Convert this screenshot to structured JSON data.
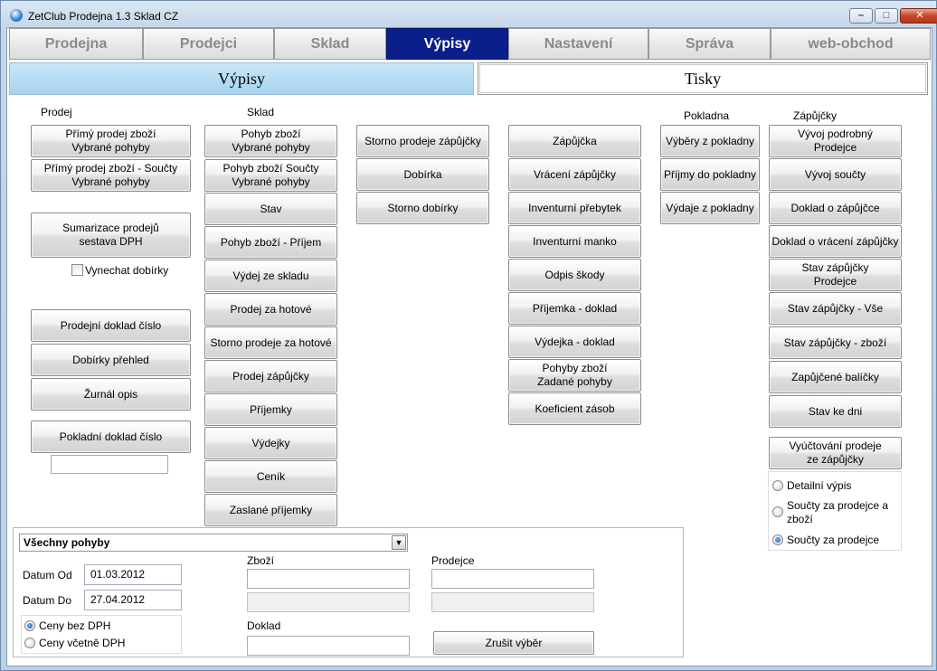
{
  "window": {
    "title": "ZetClub Prodejna 1.3  Sklad CZ",
    "controls": {
      "minimize": "–",
      "maximize": "□",
      "close": "✕"
    }
  },
  "main_tabs": [
    "Prodejna",
    "Prodejci",
    "Sklad",
    "Výpisy",
    "Nastavení",
    "Správa",
    "web-obchod"
  ],
  "active_tab": "Výpisy",
  "sub_tabs": {
    "vypisy": "Výpisy",
    "tisky": "Tisky"
  },
  "colors": {
    "active_tab_bg": "#0b1f8a",
    "subtab_active_bg": "#b8dcf4",
    "muted_tab_text": "#8a8a8a"
  },
  "prodej": {
    "heading": "Prodej",
    "buttons": [
      "Přímý prodej zboží\nVybrané pohyby",
      "Přímý prodej zboží - Součty\nVybrané pohyby",
      "Sumarizace prodejů\nsestava DPH",
      "Prodejní doklad číslo",
      "Dobírky přehled",
      "Žurnál opis",
      "Pokladní doklad číslo"
    ],
    "checkbox_label": "Vynechat dobírky",
    "doklad_input": ""
  },
  "sklad": {
    "heading": "Sklad",
    "buttons": [
      "Pohyb zboží\nVybrané pohyby",
      "Pohyb zboží Součty\nVybrané pohyby",
      "Stav",
      "Pohyb zboží - Příjem",
      "Výdej ze skladu",
      "Prodej za hotové",
      "Storno prodeje za hotové",
      "Prodej zápůjčky",
      "Příjemky",
      "Výdejky",
      "Ceník",
      "Zaslané příjemky"
    ]
  },
  "col3": {
    "buttons": [
      "Storno prodeje zápůjčky",
      "Dobírka",
      "Storno dobírky"
    ]
  },
  "col4": {
    "buttons": [
      "Zápůjčka",
      "Vrácení zápůjčky",
      "Inventurní přebytek",
      "Inventurní manko",
      "Odpis škody",
      "Příjemka - doklad",
      "Výdejka - doklad",
      "Pohyby zboží\nZadané pohyby",
      "Koeficient zásob"
    ]
  },
  "pokladna": {
    "heading": "Pokladna",
    "buttons": [
      "Výběry z pokladny",
      "Příjmy do pokladny",
      "Výdaje z pokladny"
    ]
  },
  "zapujcky": {
    "heading": "Zápůjčky",
    "buttons": [
      "Vývoj podrobný\nProdejce",
      "Vývoj součty",
      "Doklad o zápůjčce",
      "Doklad o vrácení zápůjčky",
      "Stav zápůjčky\nProdejce",
      "Stav zápůjčky - Vše",
      "Stav zápůjčky - zboží",
      "Zapůjčené balíčky",
      "Stav ke dni",
      "Vyúčtování prodeje\nze zápůjčky"
    ],
    "radios": [
      "Detailní výpis",
      "Součty za prodejce a\nzboží",
      "Součty za prodejce"
    ],
    "selected_radio": "Součty za prodejce"
  },
  "filter": {
    "combo_value": "Všechny pohyby",
    "datum_od_label": "Datum Od",
    "datum_od": "01.03.2012",
    "datum_do_label": "Datum Do",
    "datum_do": "27.04.2012",
    "price_radios": [
      "Ceny bez DPH",
      "Ceny včetně DPH"
    ],
    "selected_price": "Ceny bez DPH",
    "zbozi_label": "Zboží",
    "zbozi_value": "",
    "zbozi_name": "",
    "prodejce_label": "Prodejce",
    "prodejce_value": "",
    "prodejce_name": "",
    "doklad_label": "Doklad",
    "doklad_value": "",
    "reset_button": "Zrušit výběr"
  }
}
